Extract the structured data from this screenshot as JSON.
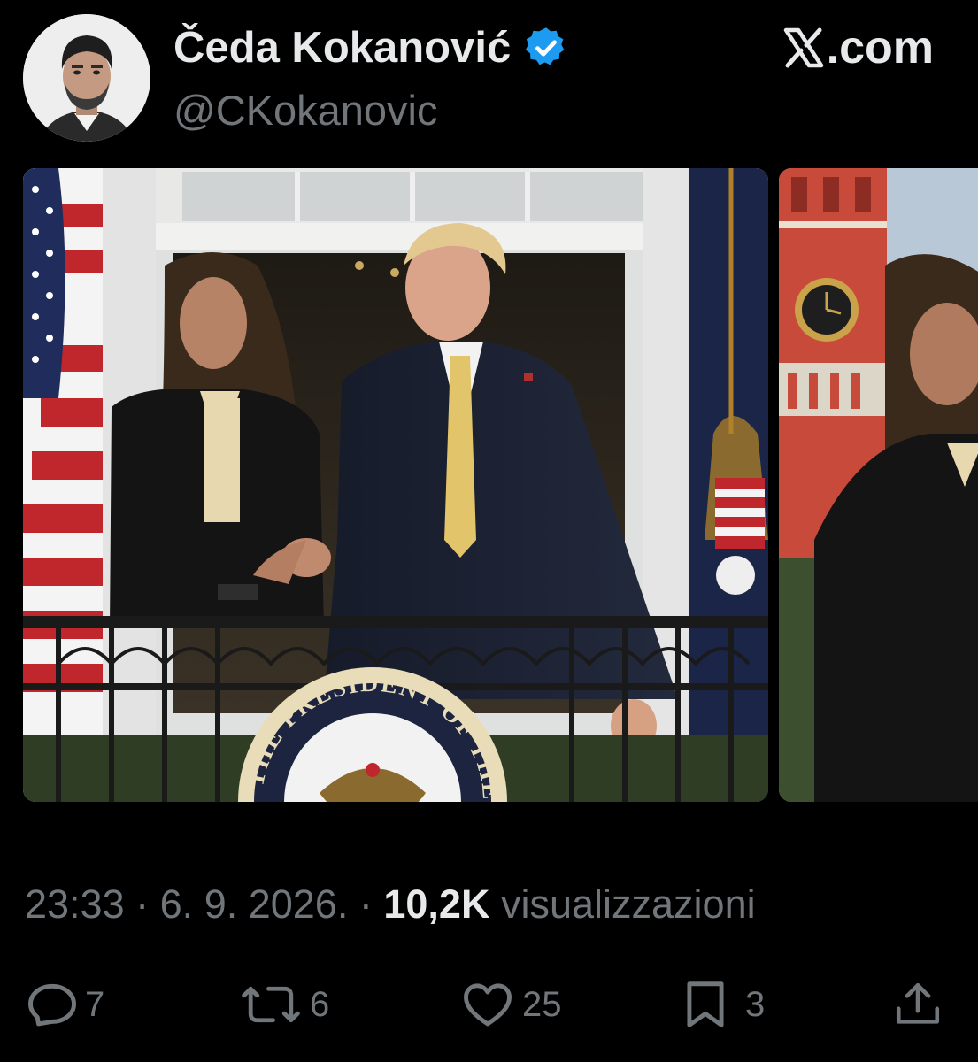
{
  "author": {
    "display_name": "Čeda Kokanović",
    "handle": "@CKokanovic",
    "verified": true,
    "avatar_icon": "profile-photo"
  },
  "brand": {
    "label": ".com",
    "logo_icon": "x-logo-icon"
  },
  "media": {
    "photo_1": {
      "description_icon": "photo",
      "seal_text": "THE PRESIDENT OF THE UNITED"
    },
    "photo_2": {
      "description_icon": "photo"
    }
  },
  "meta": {
    "time": "23:33",
    "separator": "·",
    "date": "6. 9. 2026.",
    "views_count": "10,2K",
    "views_label": "visualizzazioni"
  },
  "actions": {
    "replies": "7",
    "reposts": "6",
    "likes": "25",
    "bookmarks": "3"
  },
  "colors": {
    "background": "#000000",
    "primary_text": "#e7e9ea",
    "secondary_text": "#71767b",
    "verified_blue": "#1d9bf0"
  }
}
